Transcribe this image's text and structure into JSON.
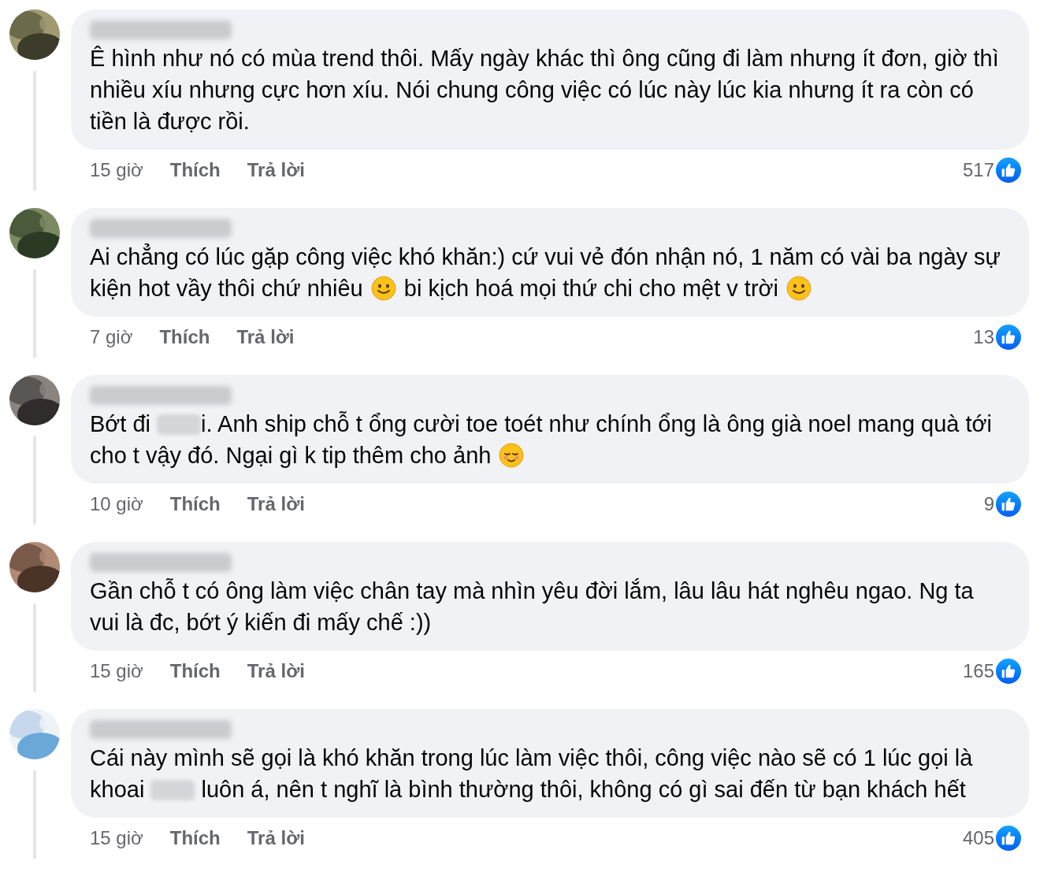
{
  "comments": [
    {
      "segments": [
        {
          "kind": "text",
          "text": "Ê hình như nó có mùa trend thôi. Mấy ngày khác thì ông cũng đi làm nhưng ít đơn, giờ thì nhiều xíu nhưng cực hơn xíu. Nói chung công việc có lúc này lúc kia nhưng ít ra còn có tiền là được rồi."
        }
      ],
      "time": "15 giờ",
      "like_label": "Thích",
      "reply_label": "Trả lời",
      "reaction_count": "517"
    },
    {
      "segments": [
        {
          "kind": "text",
          "text": "Ai chẳng có lúc gặp công việc khó khăn:) cứ vui vẻ đón nhận nó, 1 năm có vài ba ngày sự kiện hot vầy thôi chứ nhiêu "
        },
        {
          "kind": "smile"
        },
        {
          "kind": "text",
          "text": " bi kịch hoá mọi thứ chi cho mệt v trời "
        },
        {
          "kind": "smile"
        }
      ],
      "time": "7 giờ",
      "like_label": "Thích",
      "reply_label": "Trả lời",
      "reaction_count": "13"
    },
    {
      "segments": [
        {
          "kind": "text",
          "text": "Bớt đi "
        },
        {
          "kind": "blur"
        },
        {
          "kind": "text",
          "text": "i. Anh ship chỗ t ổng cười toe toét như chính ổng là ông già noel mang quà tới cho t vậy đó. Ngại gì k tip thêm cho ảnh "
        },
        {
          "kind": "relieved"
        }
      ],
      "time": "10 giờ",
      "like_label": "Thích",
      "reply_label": "Trả lời",
      "reaction_count": "9"
    },
    {
      "segments": [
        {
          "kind": "text",
          "text": "Gần chỗ t có ông làm việc chân tay mà nhìn yêu đời lắm, lâu lâu hát nghêu ngao. Ng ta vui là đc, bớt ý kiến đi mấy chế :))"
        }
      ],
      "time": "15 giờ",
      "like_label": "Thích",
      "reply_label": "Trả lời",
      "reaction_count": "165"
    },
    {
      "segments": [
        {
          "kind": "text",
          "text": "Cái này mình sẽ gọi là khó khăn trong lúc làm việc thôi, công việc nào sẽ có 1 lúc gọi là khoai "
        },
        {
          "kind": "blur"
        },
        {
          "kind": "text",
          "text": " luôn á, nên t nghĩ là bình thường thôi, không có gì sai đến từ bạn khách hết"
        }
      ],
      "time": "15 giờ",
      "like_label": "Thích",
      "reply_label": "Trả lời",
      "reaction_count": "405"
    }
  ]
}
